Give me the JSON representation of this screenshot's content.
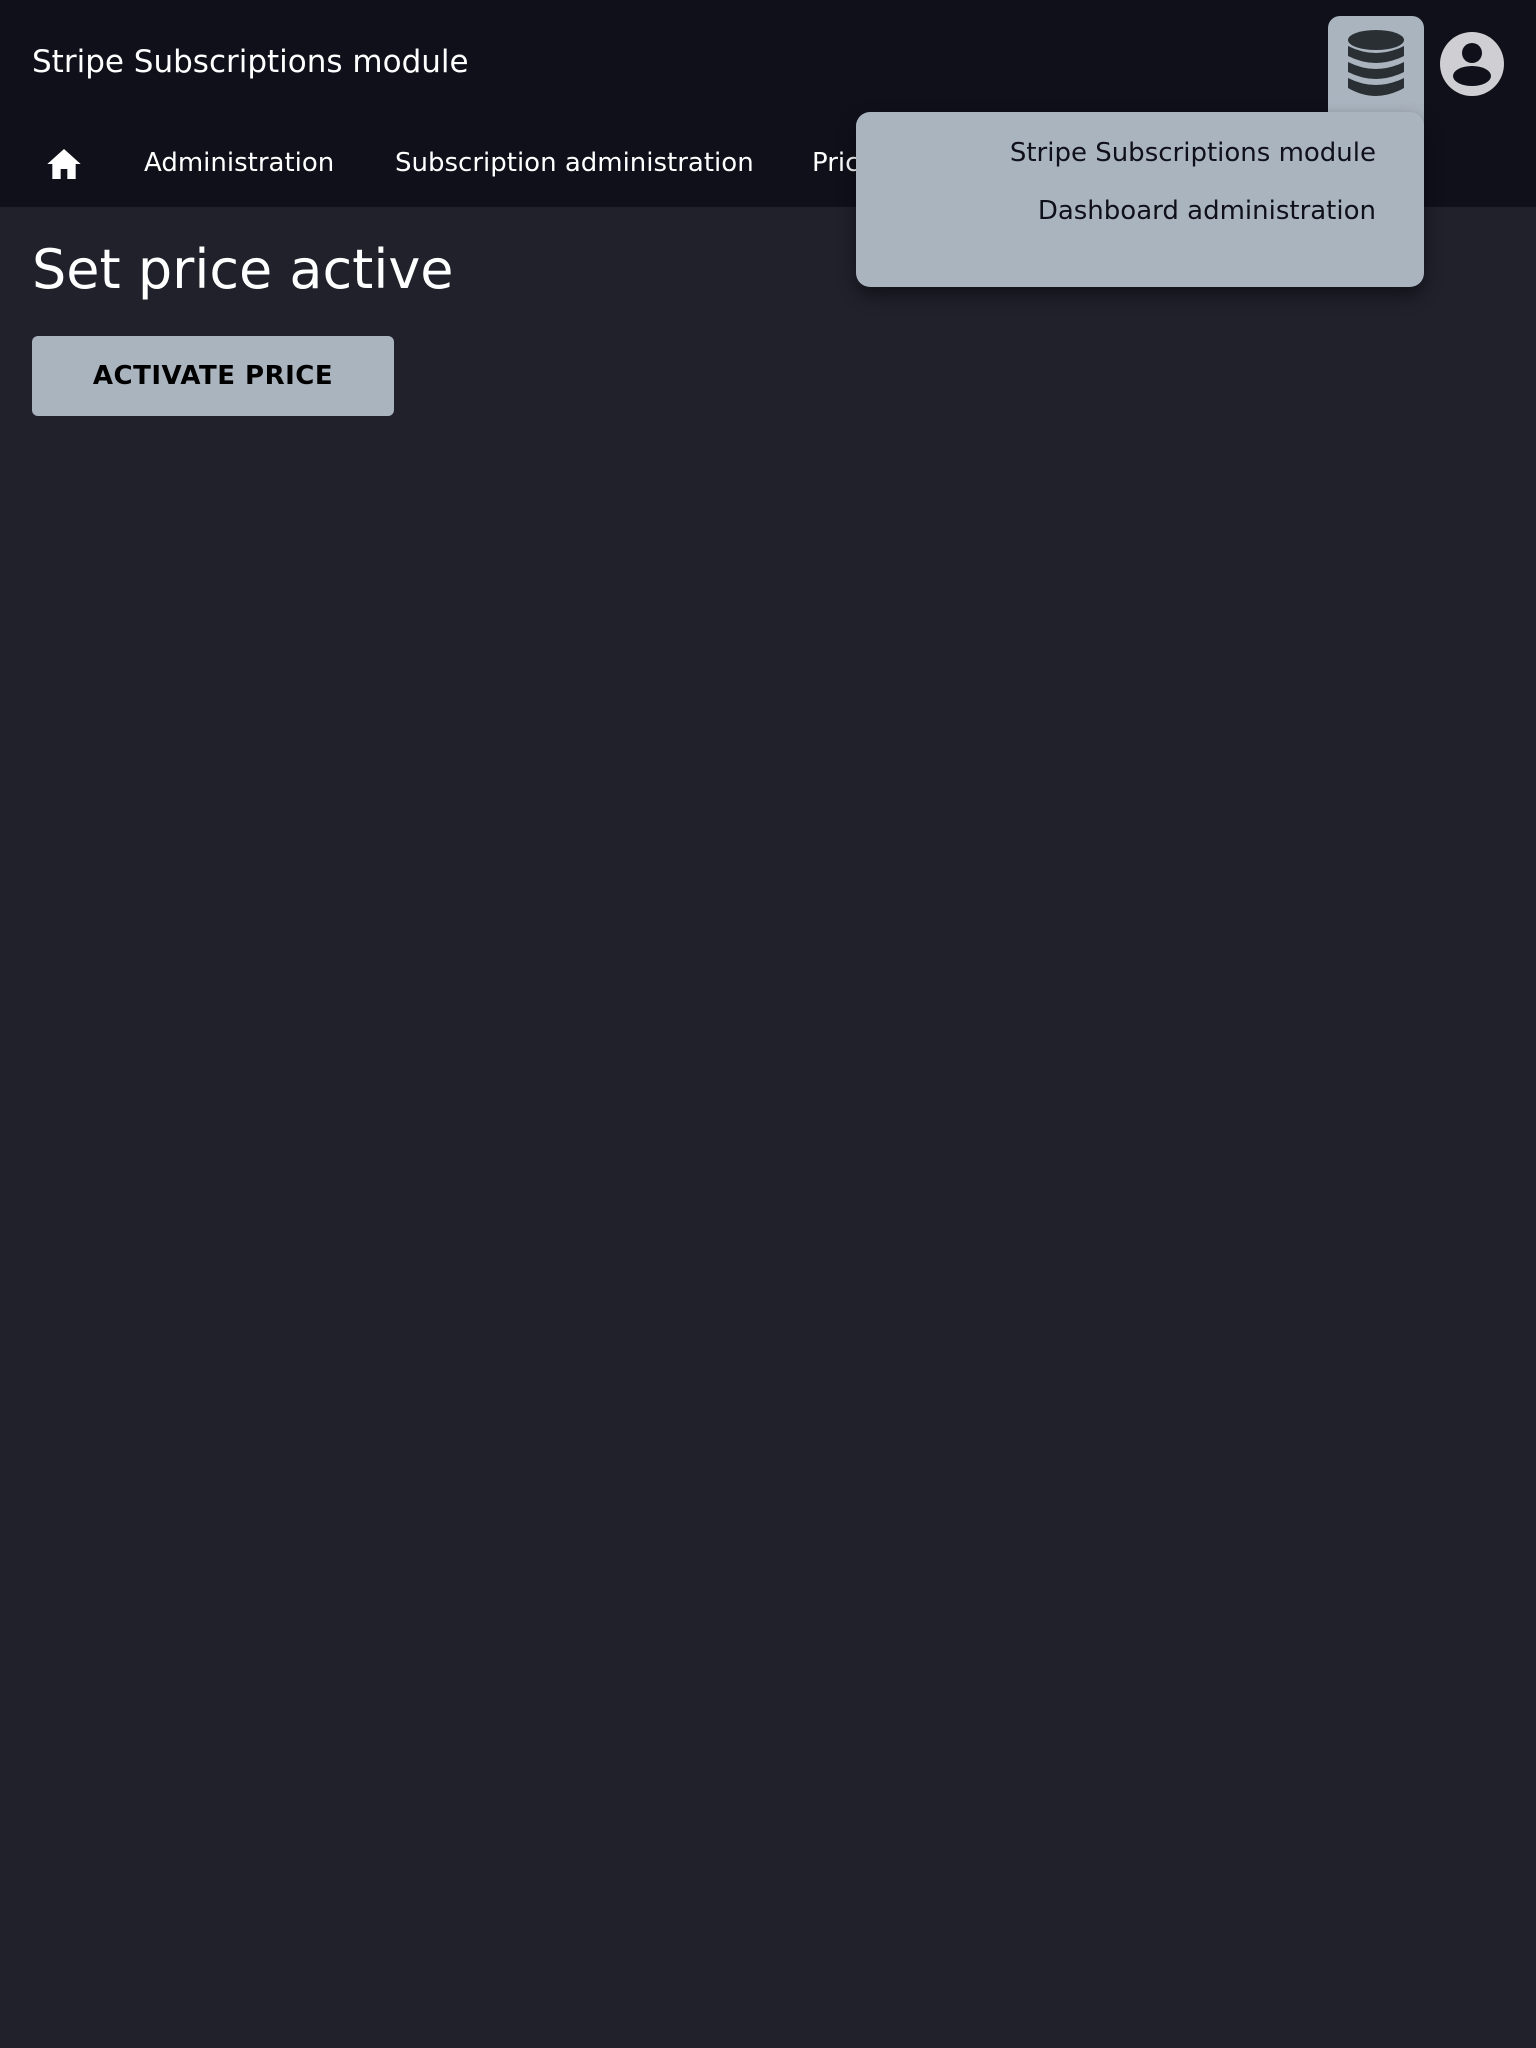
{
  "header": {
    "app_title": "Stripe Subscriptions module",
    "db_icon": "database-icon",
    "avatar_icon": "account-circle-icon"
  },
  "nav": {
    "home_icon": "home-icon",
    "items": [
      {
        "label": "Administration"
      },
      {
        "label": "Subscription administration"
      },
      {
        "label": "Pric"
      }
    ]
  },
  "dropdown": {
    "items": [
      {
        "label": "Stripe Subscriptions module"
      },
      {
        "label": "Dashboard administration"
      }
    ]
  },
  "main": {
    "title": "Set price active",
    "activate_label": "ACTIVATE PRICE"
  },
  "colors": {
    "background": "#20212b",
    "topbar": "#0f101a",
    "accent": "#aab4bf",
    "text": "#ffffff"
  }
}
